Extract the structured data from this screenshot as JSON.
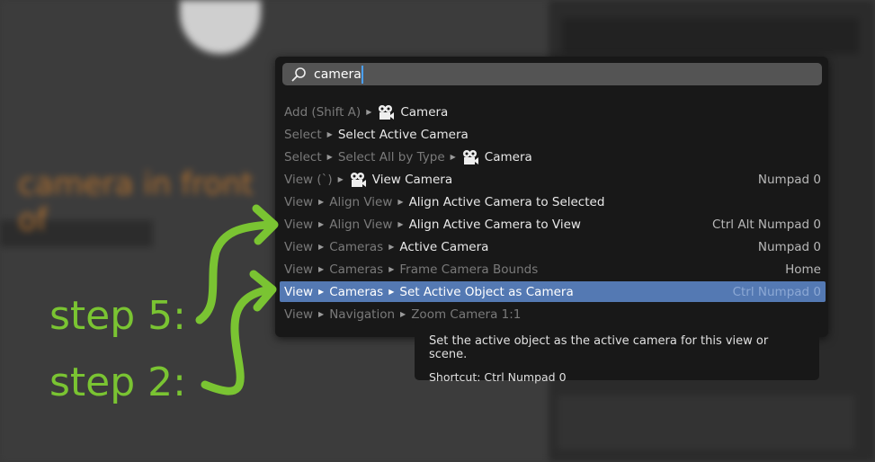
{
  "search": {
    "value": "camera",
    "icon": "search-icon"
  },
  "results": [
    {
      "path": [
        "Add (Shift A)"
      ],
      "label": "Camera",
      "icon": "camera-icon",
      "shortcut": ""
    },
    {
      "path": [
        "Select"
      ],
      "label": "Select Active Camera",
      "shortcut": ""
    },
    {
      "path": [
        "Select",
        "Select All by Type"
      ],
      "label": "Camera",
      "icon": "camera-icon",
      "shortcut": ""
    },
    {
      "path": [
        "View (`)"
      ],
      "label": "View Camera",
      "icon": "view-camera-icon",
      "shortcut": "Numpad 0"
    },
    {
      "path": [
        "View",
        "Align View"
      ],
      "label": "Align Active Camera to Selected",
      "shortcut": ""
    },
    {
      "path": [
        "View",
        "Align View"
      ],
      "label": "Align Active Camera to View",
      "shortcut": "Ctrl Alt Numpad 0"
    },
    {
      "path": [
        "View",
        "Cameras"
      ],
      "label": "Active Camera",
      "shortcut": "Numpad 0"
    },
    {
      "path": [
        "View",
        "Cameras"
      ],
      "label": "Frame Camera Bounds",
      "shortcut": "Home",
      "dim": true
    },
    {
      "path": [
        "View",
        "Cameras"
      ],
      "label": "Set Active Object as Camera",
      "shortcut": "Ctrl Numpad 0",
      "selected": true
    },
    {
      "path": [
        "View",
        "Navigation"
      ],
      "label": "Zoom Camera 1:1",
      "shortcut": "",
      "dim": true
    }
  ],
  "tooltip": {
    "description": "Set the active object as the active camera for this view or scene.",
    "shortcut": "Shortcut: Ctrl Numpad 0"
  },
  "annotations": {
    "step5": "step 5:",
    "step2": "step 2:",
    "color": "#7ac432"
  },
  "colors": {
    "highlight": "#5479b3",
    "popup": "#181818"
  }
}
